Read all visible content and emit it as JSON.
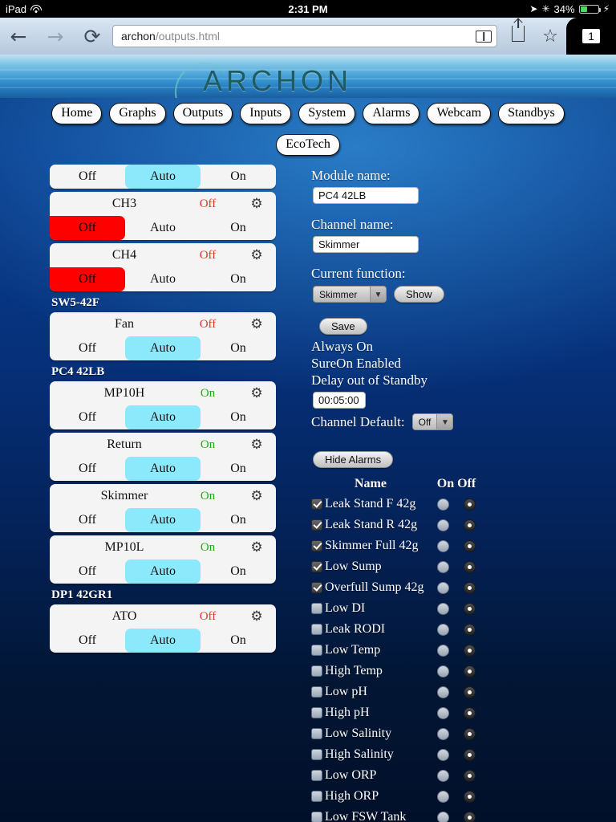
{
  "status_bar": {
    "device": "iPad",
    "wifi_icon": "wifi-icon",
    "time": "2:31 PM",
    "location_icon": "location-arrow-icon",
    "bluetooth_icon": "bluetooth-icon",
    "battery_percent": "34%",
    "battery_icon": "battery-icon",
    "charging_icon": "lightning-bolt-icon"
  },
  "browser": {
    "back_icon": "back-arrow-icon",
    "forward_icon": "forward-arrow-icon",
    "reload_icon": "reload-icon",
    "url_host": "archon",
    "url_path": "/outputs.html",
    "reader_icon": "reader-view-icon",
    "share_icon": "share-icon",
    "bookmark_icon": "bookmark-star-icon",
    "tab_count": "1"
  },
  "banner": {
    "logo_text": "ARCHON"
  },
  "nav": {
    "tabs": [
      {
        "label": "Home"
      },
      {
        "label": "Graphs"
      },
      {
        "label": "Outputs"
      },
      {
        "label": "Inputs"
      },
      {
        "label": "System"
      },
      {
        "label": "Alarms"
      },
      {
        "label": "Webcam"
      },
      {
        "label": "Standbys"
      }
    ],
    "second_row": [
      {
        "label": "EcoTech"
      }
    ]
  },
  "channel_list": {
    "mode_labels": {
      "off": "Off",
      "auto": "Auto",
      "on": "On"
    },
    "gear_icon": "gear-icon",
    "entries": [
      {
        "type": "channel",
        "partial": true,
        "name": "",
        "state": "",
        "state_class": "",
        "selected": "auto"
      },
      {
        "type": "channel",
        "name": "CH3",
        "state": "Off",
        "state_class": "off",
        "selected": "off"
      },
      {
        "type": "channel",
        "name": "CH4",
        "state": "Off",
        "state_class": "off",
        "selected": "off"
      },
      {
        "type": "group",
        "label": "SW5-42F"
      },
      {
        "type": "channel",
        "name": "Fan",
        "state": "Off",
        "state_class": "off",
        "selected": "auto"
      },
      {
        "type": "group",
        "label": "PC4 42LB"
      },
      {
        "type": "channel",
        "name": "MP10H",
        "state": "On",
        "state_class": "on",
        "selected": "auto"
      },
      {
        "type": "channel",
        "name": "Return",
        "state": "On",
        "state_class": "on",
        "selected": "auto"
      },
      {
        "type": "channel",
        "name": "Skimmer",
        "state": "On",
        "state_class": "on",
        "selected": "auto"
      },
      {
        "type": "channel",
        "name": "MP10L",
        "state": "On",
        "state_class": "on",
        "selected": "auto"
      },
      {
        "type": "group",
        "label": "DP1 42GR1"
      },
      {
        "type": "channel",
        "name": "ATO",
        "state": "Off",
        "state_class": "off",
        "selected": "auto"
      }
    ]
  },
  "detail": {
    "module_name_label": "Module name:",
    "module_name_value": "PC4 42LB",
    "channel_name_label": "Channel name:",
    "channel_name_value": "Skimmer",
    "current_function_label": "Current function:",
    "current_function_value": "Skimmer",
    "show_button": "Show",
    "save_button": "Save",
    "always_on": "Always On",
    "sure_on": "SureOn Enabled",
    "delay_label": "Delay out of Standby",
    "delay_value": "00:05:00",
    "channel_default_label": "Channel Default:",
    "channel_default_value": "Off",
    "dropdown_icon": "chevron-down-icon"
  },
  "alarms": {
    "hide_button": "Hide Alarms",
    "header_name": "Name",
    "header_onoff": "On Off",
    "rows": [
      {
        "name": "Leak Stand F 42g",
        "checked": true,
        "state": "off"
      },
      {
        "name": "Leak Stand R 42g",
        "checked": true,
        "state": "off"
      },
      {
        "name": "Skimmer Full 42g",
        "checked": true,
        "state": "off"
      },
      {
        "name": "Low Sump",
        "checked": true,
        "state": "off"
      },
      {
        "name": "Overfull Sump 42g",
        "checked": true,
        "state": "off"
      },
      {
        "name": "Low DI",
        "checked": false,
        "state": "off"
      },
      {
        "name": "Leak RODI",
        "checked": false,
        "state": "off"
      },
      {
        "name": "Low Temp",
        "checked": false,
        "state": "off"
      },
      {
        "name": "High Temp",
        "checked": false,
        "state": "off"
      },
      {
        "name": "Low pH",
        "checked": false,
        "state": "off"
      },
      {
        "name": "High pH",
        "checked": false,
        "state": "off"
      },
      {
        "name": "Low Salinity",
        "checked": false,
        "state": "off"
      },
      {
        "name": "High Salinity",
        "checked": false,
        "state": "off"
      },
      {
        "name": "Low ORP",
        "checked": false,
        "state": "off"
      },
      {
        "name": "High ORP",
        "checked": false,
        "state": "off"
      },
      {
        "name": "Low FSW Tank",
        "checked": false,
        "state": "off"
      }
    ]
  },
  "colors": {
    "selected_auto": "#8ce8fb",
    "selected_off": "#ff0000",
    "state_on": "#12b312",
    "state_off": "#e8302a",
    "page_blue": "#0a3d87"
  }
}
